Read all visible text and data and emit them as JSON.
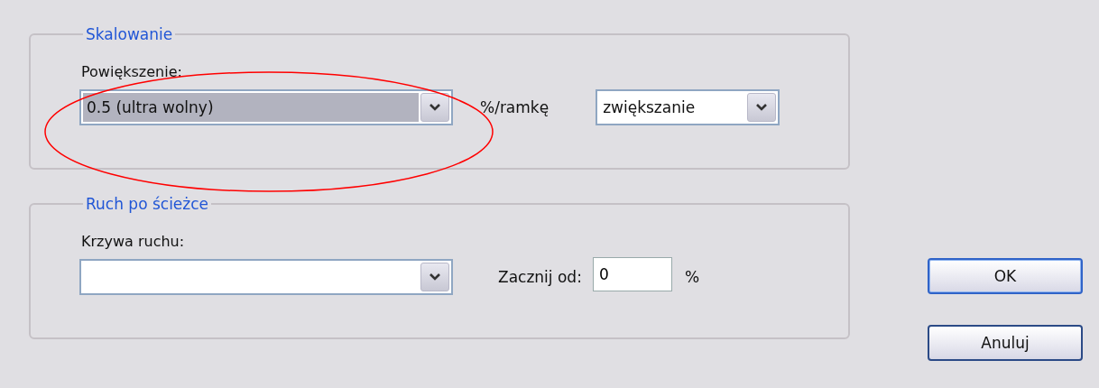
{
  "scaling": {
    "title": "Skalowanie",
    "zoom_label": "Powiększenie:",
    "zoom_value": "0.5 (ultra wolny)",
    "zoom_highlighted": true,
    "unit": "%/ramkę",
    "direction_value": "zwiększanie"
  },
  "path_motion": {
    "title": "Ruch po ścieżce",
    "curve_label": "Krzywa ruchu:",
    "start_label": "Zacznij od:",
    "start_value": "0",
    "start_unit": "%"
  },
  "annotation": {
    "kind": "ellipse"
  },
  "buttons": [
    {
      "label": "OK",
      "default": true
    },
    {
      "label": "Anuluj",
      "default": false
    }
  ]
}
